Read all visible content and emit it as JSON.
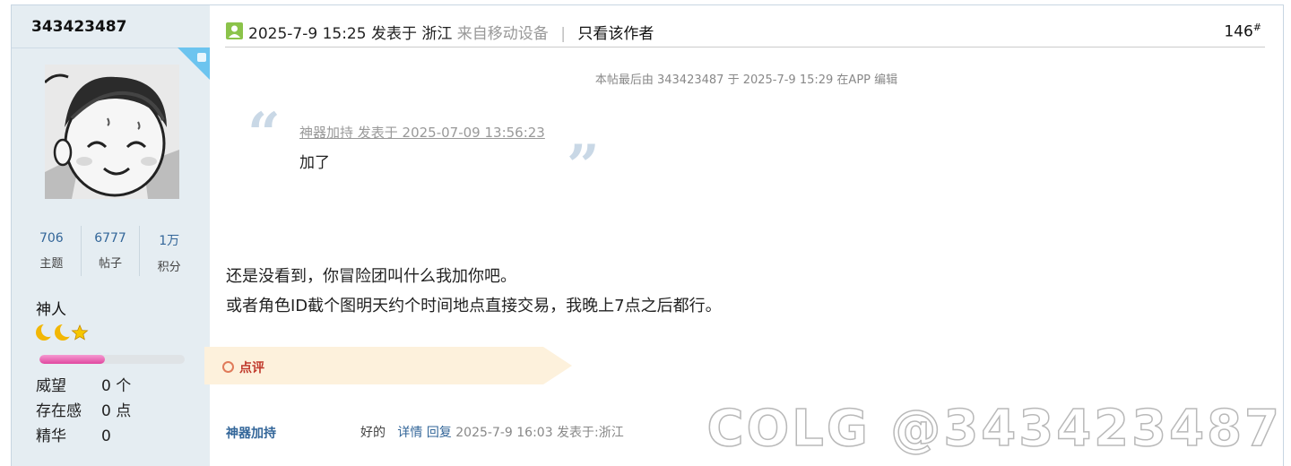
{
  "author": {
    "username": "343423487",
    "stats": [
      {
        "value": "706",
        "label": "主题"
      },
      {
        "value": "6777",
        "label": "帖子"
      },
      {
        "value": "1万",
        "label": "积分"
      }
    ],
    "rank": "神人",
    "level_progress": 0.45,
    "attributes": [
      {
        "label": "威望",
        "value": "0 个"
      },
      {
        "label": "存在感",
        "value": "0 点"
      },
      {
        "label": "精华",
        "value": "0"
      }
    ]
  },
  "post": {
    "date": "2025-7-9 15:25",
    "posted_in": "发表于 浙江",
    "from_device": "来自移动设备",
    "separator": "|",
    "author_only": "只看该作者",
    "floor": "146",
    "floor_mark": "#",
    "edit_note": "本帖最后由 343423487 于 2025-7-9 15:29 在APP 编辑",
    "quote": {
      "meta": "神器加持 发表于 2025-07-09 13:56:23",
      "text": "加了"
    },
    "body": [
      "还是没看到，你冒险团叫什么我加你吧。",
      "或者角色ID截个图明天约个时间地点直接交易，我晚上7点之后都行。"
    ]
  },
  "comments": {
    "tab_label": "点评",
    "items": [
      {
        "user": "神器加持",
        "text": "好的",
        "detail_link": "详情",
        "reply_link": "回复",
        "meta": "2025-7-9 16:03 发表于:浙江"
      }
    ]
  },
  "watermark": "COLG @343423487",
  "colors": {
    "sidebar_bg": "#e5edf2",
    "link": "#336699",
    "progress": "#e0479f",
    "comment_tab": "#fdf1dc"
  }
}
